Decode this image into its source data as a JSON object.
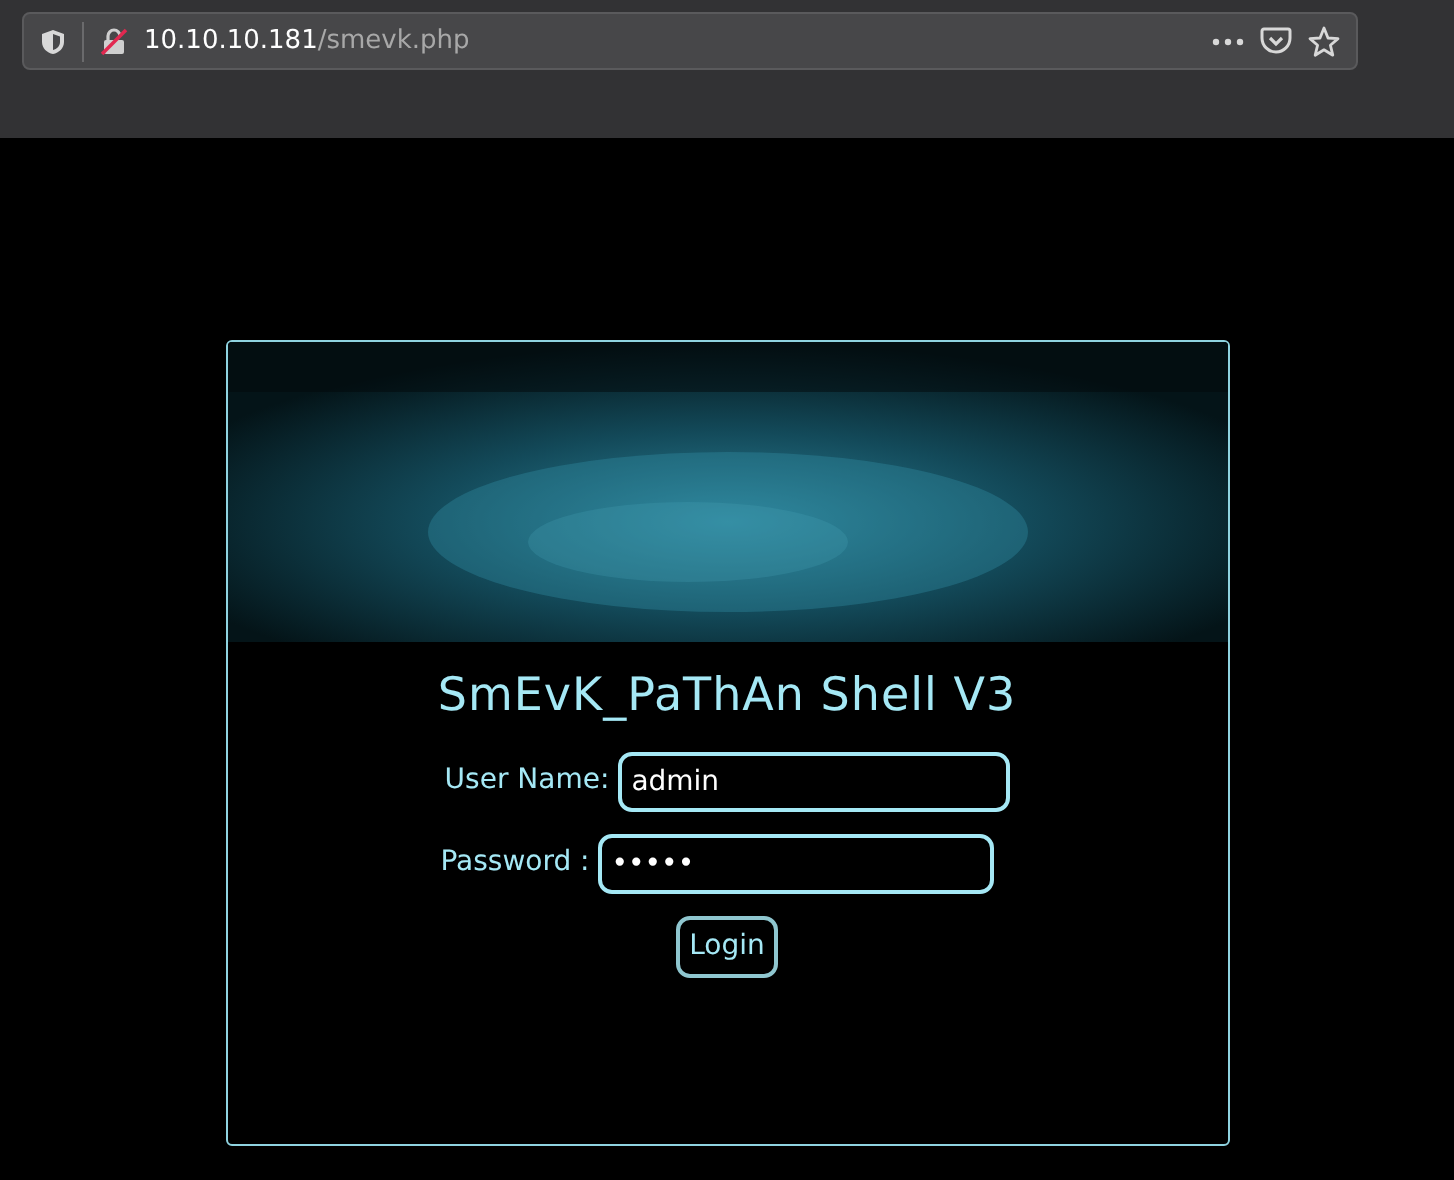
{
  "browser": {
    "url_host": "10.10.10.181",
    "url_path": "/smevk.php"
  },
  "login": {
    "title": "SmEvK_PaThAn Shell V3",
    "username_label": "User Name:",
    "username_value": "admin",
    "password_label": "Password :",
    "password_value": "•••••",
    "button": "Login"
  }
}
